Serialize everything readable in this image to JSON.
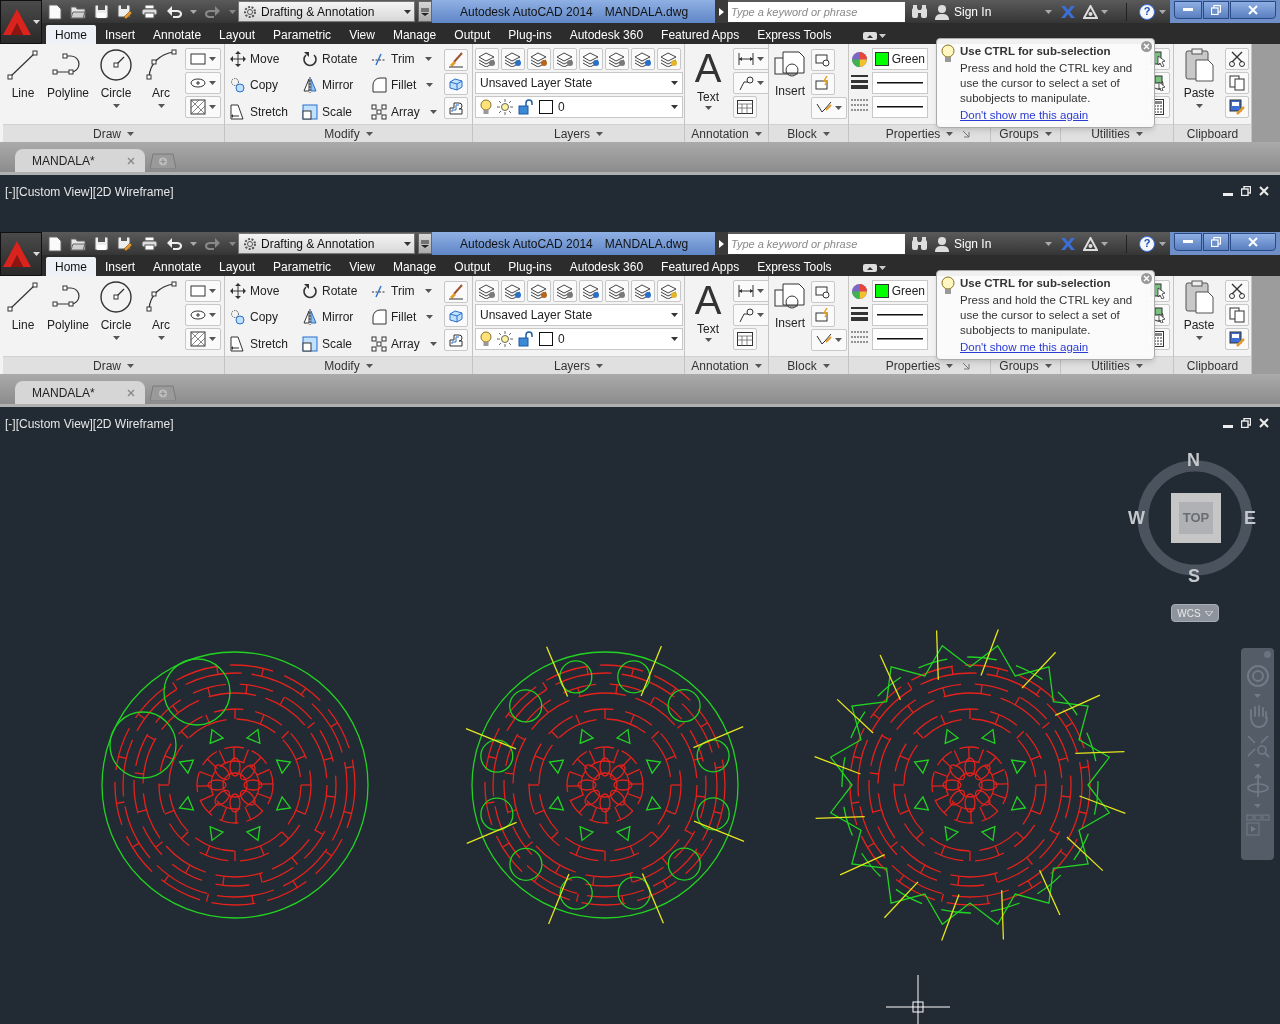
{
  "screens": [
    {
      "title_bar": {
        "workspace": "Drafting & Annotation",
        "app_name": "Autodesk AutoCAD 2014",
        "file_name": "MANDALA.dwg",
        "search": {
          "placeholder": "Type a keyword or phrase"
        },
        "sign_in": "Sign In",
        "help": "?"
      },
      "ribbon_tabs": [
        {
          "label": "Home",
          "selected": true
        },
        {
          "label": "Insert",
          "selected": false
        },
        {
          "label": "Annotate",
          "selected": false
        },
        {
          "label": "Layout",
          "selected": false
        },
        {
          "label": "Parametric",
          "selected": false
        },
        {
          "label": "View",
          "selected": false
        },
        {
          "label": "Manage",
          "selected": false
        },
        {
          "label": "Output",
          "selected": false
        },
        {
          "label": "Plug-ins",
          "selected": false
        },
        {
          "label": "Autodesk 360",
          "selected": false
        },
        {
          "label": "Featured Apps",
          "selected": false
        },
        {
          "label": "Express Tools",
          "selected": false
        }
      ],
      "panels": {
        "draw": {
          "title": "Draw",
          "tools": [
            {
              "label": "Line",
              "dropdown": false
            },
            {
              "label": "Polyline",
              "dropdown": false
            },
            {
              "label": "Circle",
              "dropdown": true
            },
            {
              "label": "Arc",
              "dropdown": true
            }
          ]
        },
        "modify": {
          "title": "Modify",
          "tools": [
            {
              "label": "Move",
              "dropdown": false
            },
            {
              "label": "Rotate",
              "dropdown": false
            },
            {
              "label": "Trim",
              "dropdown": true
            },
            {
              "label": "Copy",
              "dropdown": false
            },
            {
              "label": "Mirror",
              "dropdown": false
            },
            {
              "label": "Fillet",
              "dropdown": true
            },
            {
              "label": "Stretch",
              "dropdown": false
            },
            {
              "label": "Scale",
              "dropdown": false
            },
            {
              "label": "Array",
              "dropdown": true
            }
          ]
        },
        "layers": {
          "title": "Layers",
          "layer_state": "Unsaved Layer State",
          "current_layer": "0"
        },
        "annotation": {
          "title": "Annotation",
          "glyph": "A",
          "tool": "Text"
        },
        "block": {
          "title": "Block",
          "tool": "Insert"
        },
        "properties": {
          "title": "Properties",
          "color_setting": "Green"
        },
        "groups": {
          "title": "Groups"
        },
        "utilities": {
          "title": "Utilities"
        },
        "clipboard": {
          "title": "Clipboard",
          "tool": "Paste"
        }
      },
      "tooltip": {
        "title": "Use CTRL for sub-selection",
        "body": "Press and hold the CTRL key and use the cursor to select a set of subobjects to manipulate.",
        "link": "Don't show me this again"
      },
      "file_tabs": [
        {
          "label": "MANDALA*",
          "selected": true
        }
      ],
      "viewport": {
        "label": "[-][Custom View][2D Wireframe]"
      }
    },
    {
      "title_bar": {
        "workspace": "Drafting & Annotation",
        "app_name": "Autodesk AutoCAD 2014",
        "file_name": "MANDALA.dwg",
        "search": {
          "placeholder": "Type a keyword or phrase"
        },
        "sign_in": "Sign In",
        "help": "?"
      },
      "ribbon_tabs": [
        {
          "label": "Home",
          "selected": true
        },
        {
          "label": "Insert",
          "selected": false
        },
        {
          "label": "Annotate",
          "selected": false
        },
        {
          "label": "Layout",
          "selected": false
        },
        {
          "label": "Parametric",
          "selected": false
        },
        {
          "label": "View",
          "selected": false
        },
        {
          "label": "Manage",
          "selected": false
        },
        {
          "label": "Output",
          "selected": false
        },
        {
          "label": "Plug-ins",
          "selected": false
        },
        {
          "label": "Autodesk 360",
          "selected": false
        },
        {
          "label": "Featured Apps",
          "selected": false
        },
        {
          "label": "Express Tools",
          "selected": false
        }
      ],
      "panels": {
        "draw": {
          "title": "Draw",
          "tools": [
            {
              "label": "Line",
              "dropdown": false
            },
            {
              "label": "Polyline",
              "dropdown": false
            },
            {
              "label": "Circle",
              "dropdown": true
            },
            {
              "label": "Arc",
              "dropdown": true
            }
          ]
        },
        "modify": {
          "title": "Modify",
          "tools": [
            {
              "label": "Move",
              "dropdown": false
            },
            {
              "label": "Rotate",
              "dropdown": false
            },
            {
              "label": "Trim",
              "dropdown": true
            },
            {
              "label": "Copy",
              "dropdown": false
            },
            {
              "label": "Mirror",
              "dropdown": false
            },
            {
              "label": "Fillet",
              "dropdown": true
            },
            {
              "label": "Stretch",
              "dropdown": false
            },
            {
              "label": "Scale",
              "dropdown": false
            },
            {
              "label": "Array",
              "dropdown": true
            }
          ]
        },
        "layers": {
          "title": "Layers",
          "layer_state": "Unsaved Layer State",
          "current_layer": "0"
        },
        "annotation": {
          "title": "Annotation",
          "glyph": "A",
          "tool": "Text"
        },
        "block": {
          "title": "Block",
          "tool": "Insert"
        },
        "properties": {
          "title": "Properties",
          "color_setting": "Green"
        },
        "groups": {
          "title": "Groups"
        },
        "utilities": {
          "title": "Utilities"
        },
        "clipboard": {
          "title": "Clipboard",
          "tool": "Paste"
        }
      },
      "tooltip": {
        "title": "Use CTRL for sub-selection",
        "body": "Press and hold the CTRL key and use the cursor to select a set of subobjects to manipulate.",
        "link": "Don't show me this again"
      },
      "file_tabs": [
        {
          "label": "MANDALA*",
          "selected": true
        }
      ],
      "viewport": {
        "label": "[-][Custom View][2D Wireframe]",
        "viewcube": {
          "face": "TOP",
          "north": "N",
          "east": "E",
          "south": "S",
          "west": "W"
        },
        "ucs_menu": "WCS",
        "drawings": [
          {
            "kind": "circles"
          },
          {
            "kind": "scalloped"
          },
          {
            "kind": "spiked"
          }
        ]
      }
    }
  ]
}
